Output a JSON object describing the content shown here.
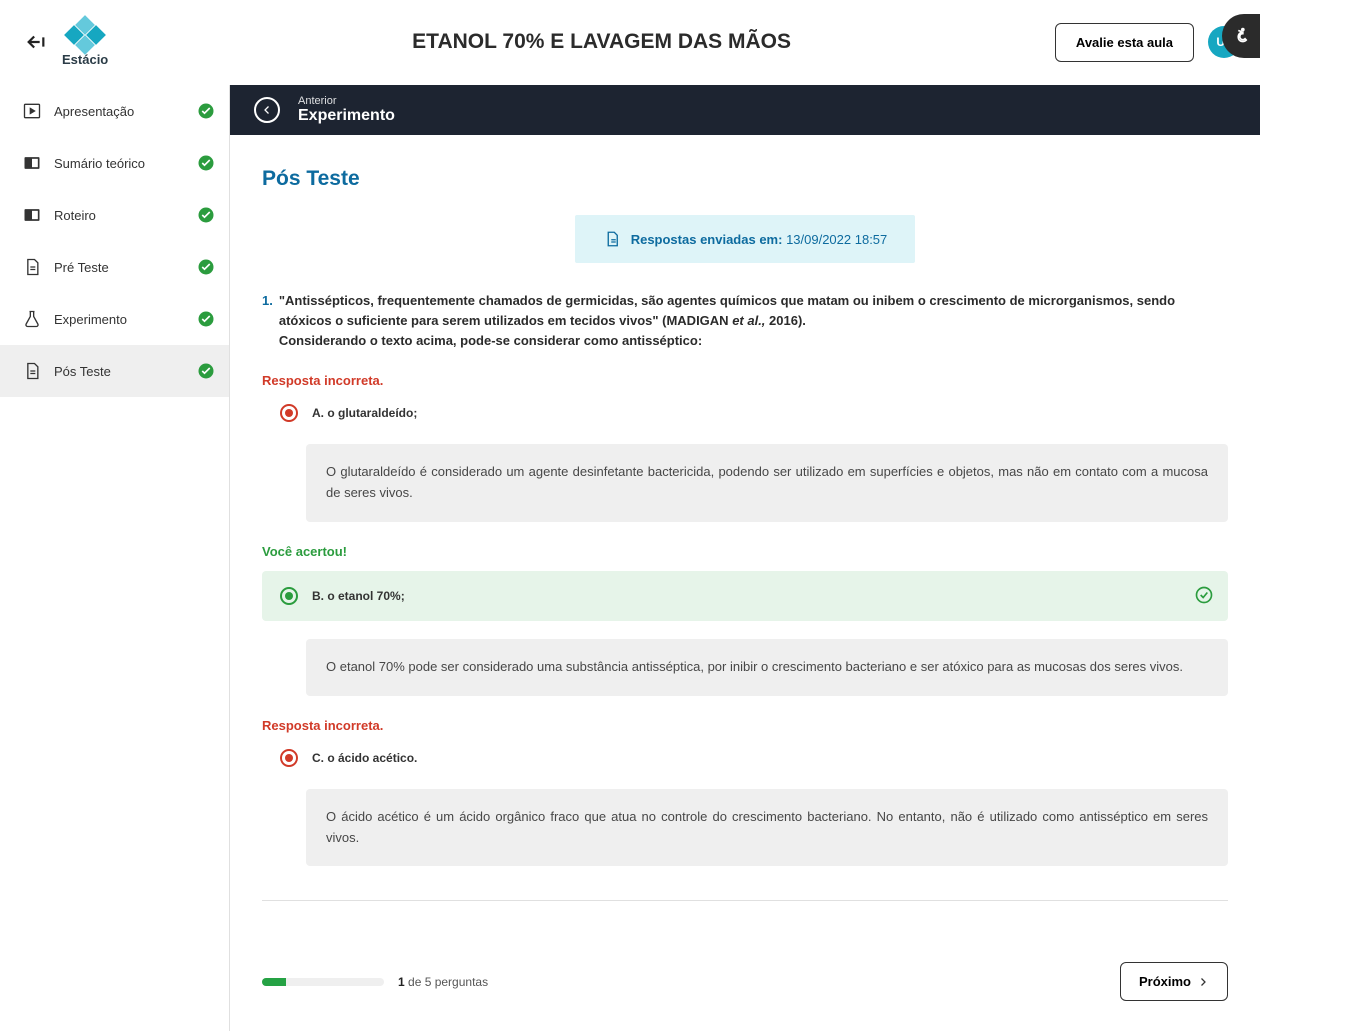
{
  "brand": "Estácio",
  "header": {
    "title": "ETANOL 70% E LAVAGEM DAS MÃOS",
    "rate_label": "Avalie esta aula",
    "badge": "U2"
  },
  "sidebar": {
    "items": [
      {
        "label": "Apresentação"
      },
      {
        "label": "Sumário teórico"
      },
      {
        "label": "Roteiro"
      },
      {
        "label": "Pré Teste"
      },
      {
        "label": "Experimento"
      },
      {
        "label": "Pós Teste"
      }
    ]
  },
  "prev_nav": {
    "small": "Anterior",
    "label": "Experimento"
  },
  "page_title": "Pós Teste",
  "notice": {
    "prefix": "Respostas enviadas em:",
    "datetime": "13/09/2022 18:57"
  },
  "question": {
    "number": "1.",
    "line1": "\"Antissépticos, frequentemente chamados de germicidas, são agentes químicos que matam ou inibem o crescimento de microrganismos, sendo atóxicos o suficiente para serem utilizados em tecidos vivos\" (MADIGAN ",
    "italic": "et al.,",
    "line1b": " 2016).",
    "line2": "Considerando o texto acima, pode-se considerar como antisséptico:"
  },
  "feedback": {
    "wrong": "Resposta incorreta.",
    "right": "Você acertou!"
  },
  "options": {
    "a": {
      "label": "A. o glutaraldeído;",
      "explain": "O glutaraldeído é considerado um agente desinfetante bactericida, podendo ser utilizado em superfícies e objetos, mas não em contato com a mucosa de seres vivos."
    },
    "b": {
      "label": "B. o etanol 70%;",
      "explain": "O etanol 70% pode ser considerado uma substância antisséptica, por inibir o crescimento bacteriano e ser atóxico para as mucosas dos seres vivos."
    },
    "c": {
      "label": "C. o ácido acético.",
      "explain": "O ácido acético é um ácido orgânico fraco que atua no controle do crescimento bacteriano. No entanto, não é utilizado como antisséptico em seres vivos."
    }
  },
  "footer": {
    "current": "1",
    "sep": " de ",
    "total": "5 perguntas",
    "next": "Próximo"
  }
}
